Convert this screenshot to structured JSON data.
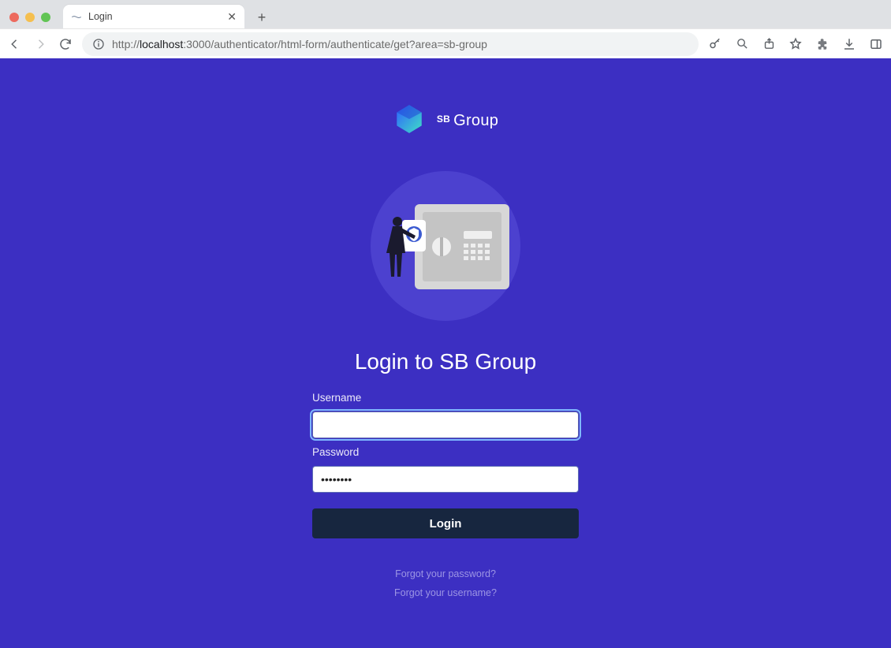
{
  "browser": {
    "tab_title": "Login",
    "close_glyph": "✕",
    "newtab_glyph": "+",
    "url_prefix": "http://",
    "url_host": "localhost",
    "url_port_path": ":3000/authenticator/html-form/authenticate/get?area=sb-group"
  },
  "brand": {
    "sb": "SB",
    "name": "Group"
  },
  "page": {
    "heading": "Login to SB Group",
    "username_label": "Username",
    "username_value": "",
    "password_label": "Password",
    "password_value": "••••••••",
    "login_button": "Login",
    "forgot_password": "Forgot your password?",
    "forgot_username": "Forgot your username?"
  }
}
